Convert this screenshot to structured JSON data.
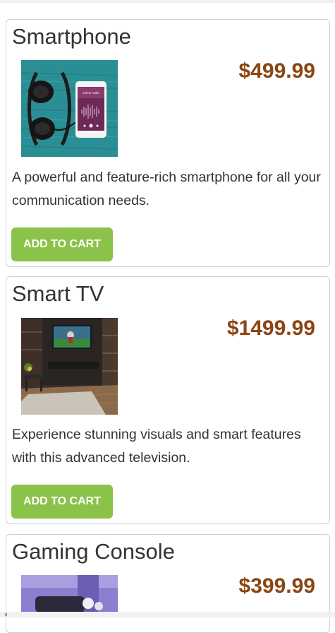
{
  "products": [
    {
      "title": "Smartphone",
      "price": "$499.99",
      "description": "A powerful and feature-rich smartphone for all your communication needs.",
      "button_label": "ADD TO CART",
      "image_caption": "online radio"
    },
    {
      "title": "Smart TV",
      "price": "$1499.99",
      "description": "Experience stunning visuals and smart features with this advanced television.",
      "button_label": "ADD TO CART"
    },
    {
      "title": "Gaming Console",
      "price": "$399.99"
    }
  ],
  "colors": {
    "price": "#8b4513",
    "button": "#8bc34a",
    "button_text": "#ffffff",
    "card_border": "#cfcfcf"
  },
  "icons": {
    "scrollbar_left": "chevron-left-icon"
  }
}
